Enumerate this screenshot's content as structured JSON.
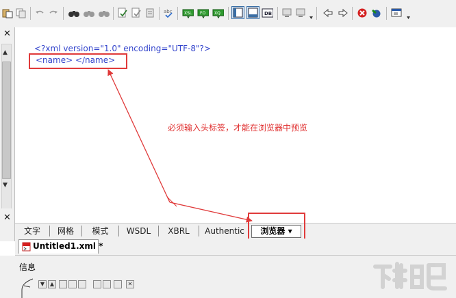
{
  "editor": {
    "line1": "<?xml version=\"1.0\" encoding=\"UTF-8\"?>",
    "line2": "<name> </name>"
  },
  "annotation": {
    "text": "必须输入头标签，才能在浏览器中预览"
  },
  "view_tabs": [
    {
      "label": "文字"
    },
    {
      "label": "网格"
    },
    {
      "label": "模式"
    },
    {
      "label": "WSDL"
    },
    {
      "label": "XBRL"
    },
    {
      "label": "Authentic"
    },
    {
      "label": "浏览器 ▾"
    }
  ],
  "document_tab": {
    "label": "Untitled1.xml *"
  },
  "info_panel": {
    "title": "信息"
  },
  "colors": {
    "annotation_red": "#e03a3a",
    "xml_blue": "#3344cc",
    "toolbar_bg": "#f0f0f0"
  },
  "icons": {
    "toolbar": [
      "paste-icon",
      "copy-icon",
      "undo-icon",
      "redo-icon",
      "find-icon",
      "find-next-icon",
      "replace-icon",
      "check-wellformed-icon",
      "validate-icon",
      "document-icon",
      "spell-check-icon",
      "xsl-transform-icon",
      "fo-transform-icon",
      "query-icon",
      "view-left-icon",
      "view-bottom-icon",
      "db-icon",
      "browser-icon",
      "tools-icon",
      "back-icon",
      "forward-icon",
      "stop-icon",
      "refresh-icon",
      "window-icon"
    ]
  }
}
